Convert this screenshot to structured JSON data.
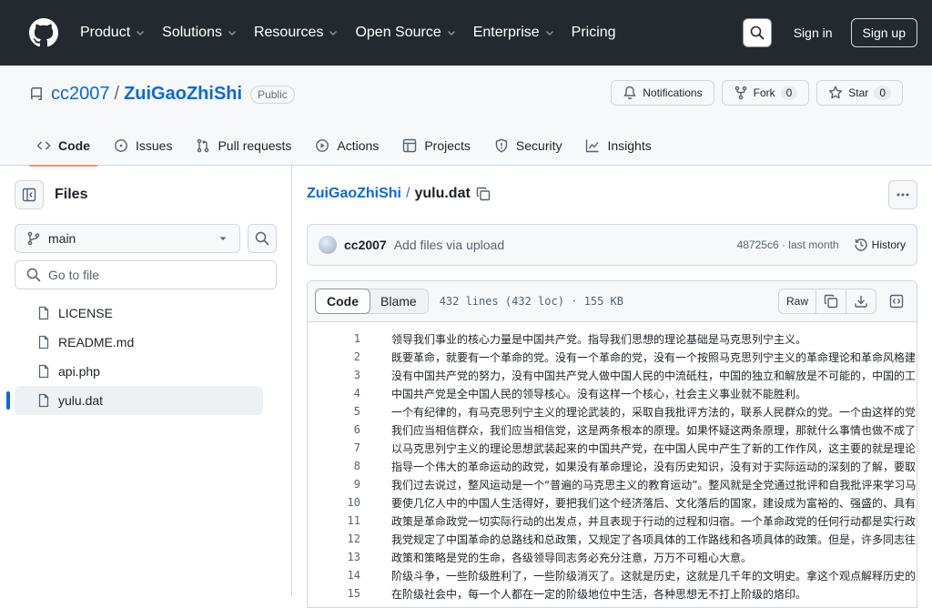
{
  "header": {
    "nav": [
      "Product",
      "Solutions",
      "Resources",
      "Open Source",
      "Enterprise",
      "Pricing"
    ],
    "nav_has_caret": [
      true,
      true,
      true,
      true,
      true,
      false
    ],
    "signin": "Sign in",
    "signup": "Sign up"
  },
  "repo": {
    "owner": "cc2007",
    "name": "ZuiGaoZhiShi",
    "visibility": "Public",
    "notifications": "Notifications",
    "fork_label": "Fork",
    "fork_count": "0",
    "star_label": "Star",
    "star_count": "0",
    "tabs": [
      "Code",
      "Issues",
      "Pull requests",
      "Actions",
      "Projects",
      "Security",
      "Insights"
    ]
  },
  "sidebar": {
    "title": "Files",
    "branch": "main",
    "goto_placeholder": "Go to file",
    "files": [
      "LICENSE",
      "README.md",
      "api.php",
      "yulu.dat"
    ],
    "active_index": 3
  },
  "file": {
    "repo_link": "ZuiGaoZhiShi",
    "name": "yulu.dat",
    "commit_author": "cc2007",
    "commit_message": "Add files via upload",
    "commit_meta": "48725c6 · last month",
    "history": "History",
    "view_code": "Code",
    "view_blame": "Blame",
    "info": "432 lines (432 loc) · 155 KB",
    "raw": "Raw",
    "lines": [
      "领导我们事业的核心力量是中国共产党。指导我们思想的理论基础是马克思列宁主义。",
      "既要革命，就要有一个革命的党。没有一个革命的党，没有一个按照马克思列宁主义的革命理论和革命风格建",
      "没有中国共产党的努力，没有中国共产党人做中国人民的中流砥柱，中国的独立和解放是不可能的，中国的工",
      "中国共产党是全中国人民的领导核心。没有这样一个核心，社会主义事业就不能胜利。",
      "一个有纪律的，有马克思列宁主义的理论武装的，采取自我批评方法的，联系人民群众的党。一个由这样的党",
      "我们应当相信群众，我们应当相信党，这是两条根本的原理。如果怀疑这两条原理，那就什么事情也做不成了",
      "以马克思列宁主义的理论思想武装起来的中国共产党，在中国人民中产生了新的工作作风，这主要的就是理论",
      "指导一个伟大的革命运动的政党，如果没有革命理论，没有历史知识，没有对于实际运动的深刻的了解，要取",
      "我们过去说过，整风运动是一个“普遍的马克思主义的教育运动”。整风就是全党通过批评和自我批评来学习马",
      "要使几亿人中的中国人生活得好，要把我们这个经济落后、文化落后的国家，建设成为富裕的、强盛的、具有",
      "政策是革命政党一切实际行动的出发点，并且表现于行动的过程和归宿。一个革命政党的任何行动都是实行政",
      "我党规定了中国革命的总路线和总政策，又规定了各项具体的工作路线和各项具体的政策。但是，许多同志往",
      "政策和策略是党的生命，各级领导同志务必充分注意，万万不可粗心大意。",
      "阶级斗争，一些阶级胜利了，一些阶级消灭了。这就是历史，这就是几千年的文明史。拿这个观点解释历史的",
      "在阶级社会中，每一个人都在一定的阶级地位中生活，各种思想无不打上阶级的烙印。"
    ]
  }
}
